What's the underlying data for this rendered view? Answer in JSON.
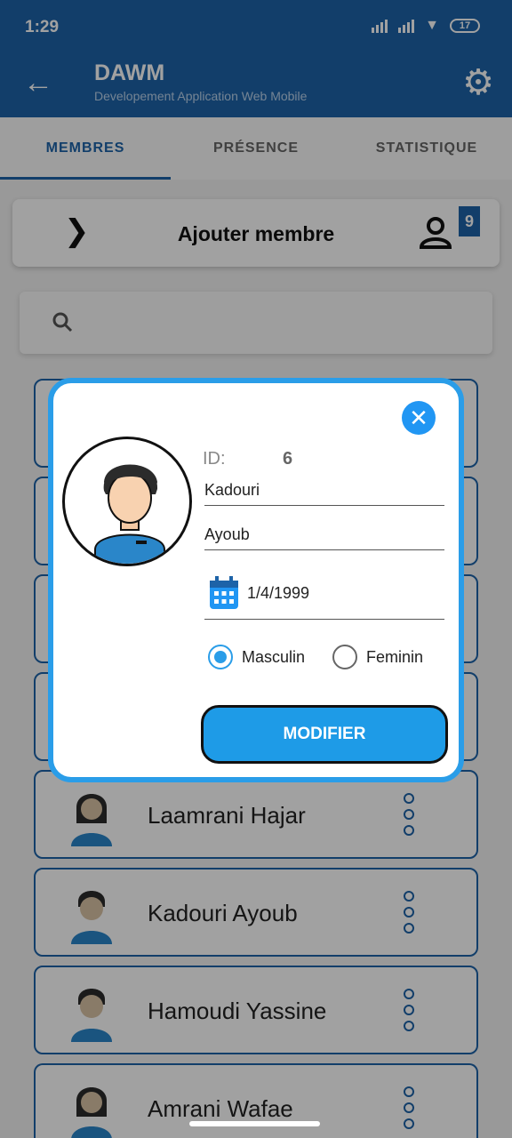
{
  "status": {
    "time": "1:29",
    "battery": "17"
  },
  "appbar": {
    "title": "DAWM",
    "subtitle": "Developement Application  Web Mobile"
  },
  "tabs": [
    {
      "label": "MEMBRES",
      "active": true
    },
    {
      "label": "PRÉSENCE",
      "active": false
    },
    {
      "label": "STATISTIQUE",
      "active": false
    }
  ],
  "add_card": {
    "label": "Ajouter membre",
    "count": "9"
  },
  "search": {
    "placeholder": ""
  },
  "members": [
    {
      "name": ""
    },
    {
      "name": ""
    },
    {
      "name": ""
    },
    {
      "name": ""
    },
    {
      "name": "Laamrani Hajar",
      "gender": "female"
    },
    {
      "name": "Kadouri Ayoub",
      "gender": "male"
    },
    {
      "name": "Hamoudi Yassine",
      "gender": "male"
    },
    {
      "name": "Amrani Wafae",
      "gender": "female"
    }
  ],
  "dialog": {
    "id_label": "ID:",
    "id_value": "6",
    "last_name": "Kadouri",
    "first_name": "Ayoub",
    "birth_date": "1/4/1999",
    "gender_male": "Masculin",
    "gender_female": "Feminin",
    "selected_gender": "Masculin",
    "submit_label": "MODIFIER"
  },
  "colors": {
    "primary": "#1d63a8",
    "accent": "#2196f3",
    "overlay": "rgba(0,0,0,0.37)"
  }
}
